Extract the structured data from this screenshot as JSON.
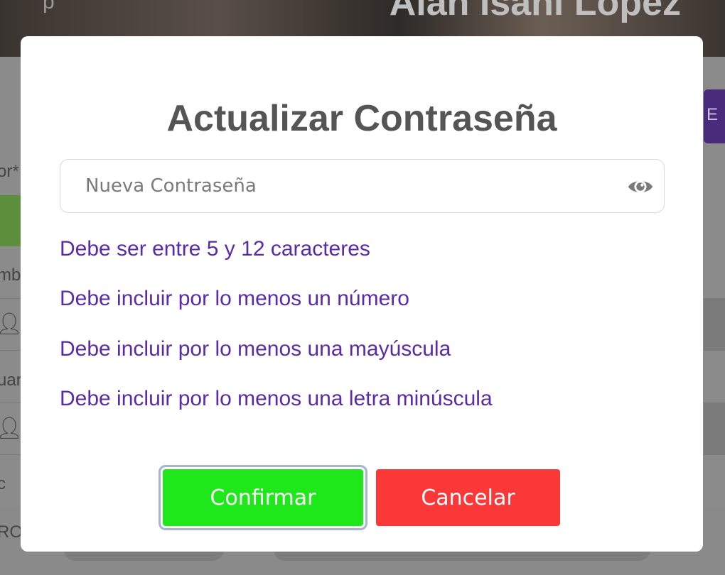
{
  "background": {
    "header_subtitle": "p",
    "header_name": "Alan Isahi Lopez",
    "left_labels": [
      "or*",
      "mb",
      "uar",
      "c",
      "RO"
    ],
    "right_tab_label": "E"
  },
  "modal": {
    "title": "Actualizar Contraseña",
    "password_field": {
      "placeholder": "Nueva Contraseña",
      "value": ""
    },
    "rules": [
      "Debe ser entre 5 y 12 caracteres",
      "Debe incluir por lo menos un número",
      "Debe incluir por lo menos una mayúscula",
      "Debe incluir por lo menos una letra minúscula"
    ],
    "confirm_label": "Confirmar",
    "cancel_label": "Cancelar"
  },
  "colors": {
    "title": "#555555",
    "rule_text": "#5b2aa5",
    "confirm_bg": "#1ee81a",
    "cancel_bg": "#fb3838",
    "overlay": "#8b8b8b"
  },
  "icons": {
    "password_toggle": "eye-icon",
    "user": "person-icon"
  }
}
